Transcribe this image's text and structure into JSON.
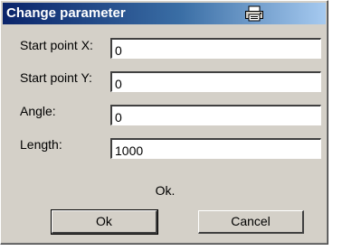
{
  "window": {
    "title": "Change parameter",
    "title_icon": "printer-icon",
    "title_gradient": [
      "#0a246a",
      "#a6caf0"
    ],
    "face_color": "#d4d0c8"
  },
  "fields": [
    {
      "label": "Start point X:",
      "value": "0"
    },
    {
      "label": "Start point Y:",
      "value": "0"
    },
    {
      "label": "Angle:",
      "value": "0"
    },
    {
      "label": "Length:",
      "value": "1000"
    }
  ],
  "status_text": "Ok.",
  "buttons": {
    "ok_label": "Ok",
    "cancel_label": "Cancel"
  }
}
